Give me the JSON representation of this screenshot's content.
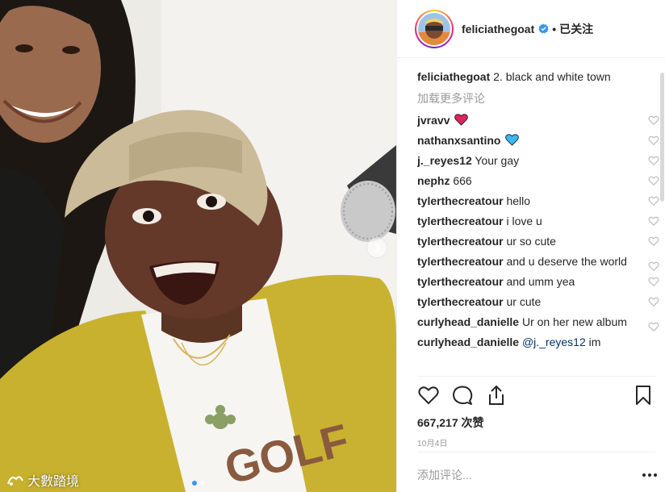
{
  "post": {
    "carousel": {
      "slide_count": 2,
      "active_slide": 1
    },
    "watermark_text": "大數踏境"
  },
  "header": {
    "username": "felicia​thegoat",
    "verified": true,
    "separator": "•",
    "follow_label": "已关注"
  },
  "caption": {
    "username": "feliciathegoat",
    "text": "2. black and white town"
  },
  "load_more_label": "加载更多评论",
  "comments": [
    {
      "username": "jvravv",
      "text": "",
      "emoji": "red-heart-emoji"
    },
    {
      "username": "nathanxsantino",
      "text": "",
      "emoji": "blue-heart-emoji"
    },
    {
      "username": "j._reyes12",
      "text": "Your gay"
    },
    {
      "username": "nephz",
      "text": "666"
    },
    {
      "username": "tylerthecreatour",
      "text": "hello"
    },
    {
      "username": "tylerthecreatour",
      "text": "i love u"
    },
    {
      "username": "tylerthecreatour",
      "text": "ur so cute"
    },
    {
      "username": "tylerthecreatour",
      "text": "and u deserve the world"
    },
    {
      "username": "tylerthecreatour",
      "text": "and umm yea"
    },
    {
      "username": "tylerthecreatour",
      "text": "ur cute"
    },
    {
      "username": "curlyhead_danielle",
      "text": "Ur on her new album"
    },
    {
      "username": "curlyhead_danielle",
      "mention": "@j._reyes12",
      "text": "im"
    }
  ],
  "actions": {
    "like_icon": "heart-outline-icon",
    "comment_icon": "speech-bubble-icon",
    "share_icon": "share-upload-icon",
    "save_icon": "bookmark-icon"
  },
  "likes_text": "667,217 次赞",
  "date_text": "10月4日",
  "add_comment_placeholder": "添加评论...",
  "more_icon": "ellipsis-icon",
  "colors": {
    "link_blue": "#003569",
    "muted": "#999999",
    "verified_blue": "#3897f0",
    "red_heart": "#e0245e",
    "blue_heart": "#3bb8f0"
  }
}
